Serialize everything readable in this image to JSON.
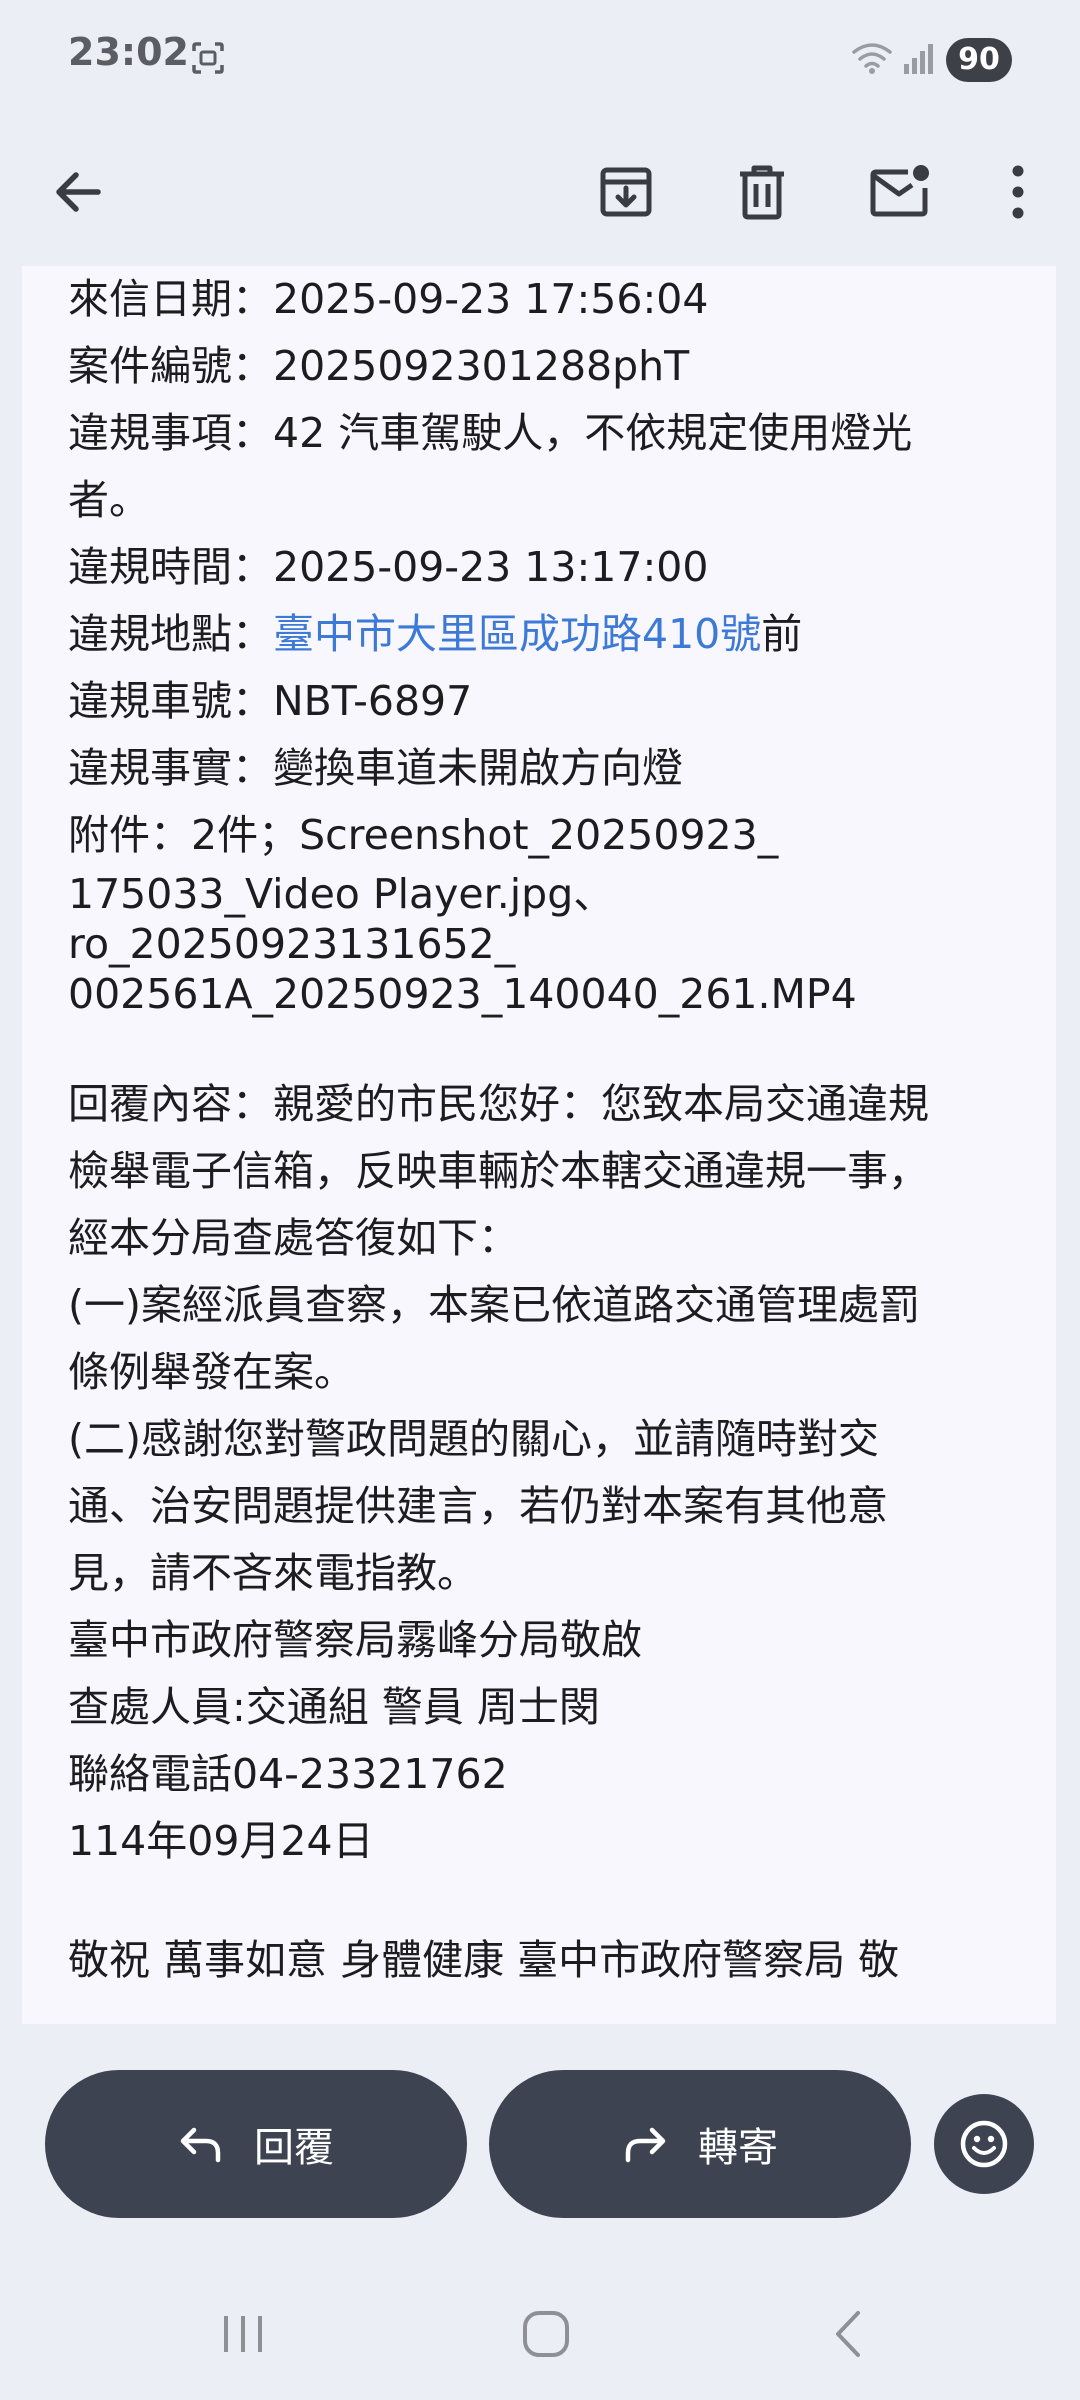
{
  "status_bar": {
    "time": "23:02",
    "battery": "90",
    "icons": [
      "screenshot-icon",
      "wifi-icon",
      "signal-icon"
    ]
  },
  "toolbar": {
    "back": "arrow-left-icon",
    "archive": "archive-icon",
    "delete": "trash-icon",
    "mark_unread": "mail-unread-icon",
    "more": "more-vert-icon"
  },
  "message": {
    "date_label": "來信日期：",
    "date_value": "2025-09-23 17:56:04",
    "case_label": "案件編號：",
    "case_value": "2025092301288phT",
    "item_label": "違規事項：",
    "item_value_line1": "42 汽車駕駛人，不依規定使用燈光",
    "item_value_line2": "者。",
    "time_label": "違規時間：",
    "time_value": "2025-09-23 13:17:00",
    "place_label": "違規地點：",
    "place_link": "臺中市大里區成功路410號",
    "place_suffix": "前",
    "plate_label": "違規車號：",
    "plate_value": "NBT-6897",
    "fact_label": "違規事實：",
    "fact_value": "變換車道未開啟方向燈",
    "attach_line1": "附件：2件；Screenshot_20250923_",
    "attach_line2": "175033_Video Player.jpg、",
    "attach_line3": "ro_20250923131652_",
    "attach_line4": "002561A_20250923_140040_261.MP4",
    "reply_line1": "回覆內容：親愛的市民您好：您致本局交通違規",
    "reply_line2": "檢舉電子信箱，反映車輛於本轄交通違規一事，",
    "reply_line3": "經本分局查處答復如下：",
    "reply_line4": "(一)案經派員查察，本案已依道路交通管理處罰",
    "reply_line5": "條例舉發在案。",
    "reply_line6": "(二)感謝您對警政問題的關心，並請隨時對交",
    "reply_line7": "通、治安問題提供建言，若仍對本案有其他意",
    "reply_line8": "見，請不吝來電指教。",
    "sign_line1": "臺中市政府警察局霧峰分局敬啟",
    "sign_line2": "查處人員:交通組 警員 周士閔",
    "sign_line3": "聯絡電話04-23321762",
    "sign_line4": "114年09月24日",
    "closing": "敬祝 萬事如意 身體健康 臺中市政府警察局 敬"
  },
  "actions": {
    "reply_label": "回覆",
    "forward_label": "轉寄"
  },
  "colors": {
    "background": "#eceef5",
    "card": "#f7f7fd",
    "link": "#3d79d6",
    "button": "#3e4352"
  }
}
